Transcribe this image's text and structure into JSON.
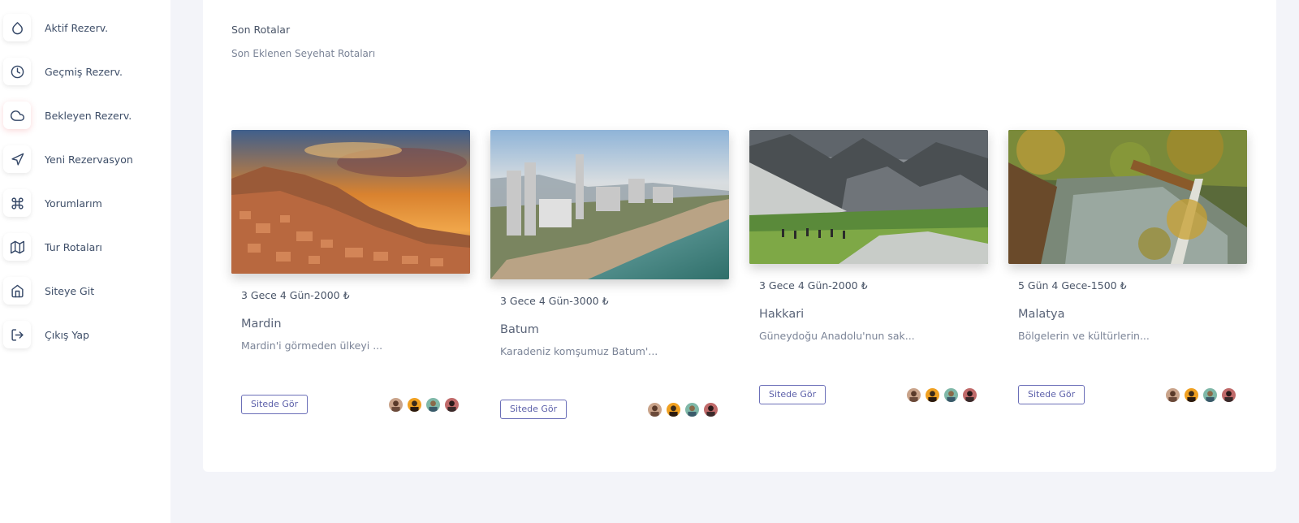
{
  "sidebar": {
    "items": [
      {
        "label": "Aktif Rezerv.",
        "icon": "droplet-icon"
      },
      {
        "label": "Geçmiş Rezerv.",
        "icon": "clock-icon"
      },
      {
        "label": "Bekleyen Rezerv.",
        "icon": "cloud-icon"
      },
      {
        "label": "Yeni Rezervasyon",
        "icon": "navigation-icon"
      },
      {
        "label": "Yorumlarım",
        "icon": "command-icon"
      },
      {
        "label": "Tur Rotaları",
        "icon": "map-icon"
      },
      {
        "label": "Siteye Git",
        "icon": "home-icon"
      },
      {
        "label": "Çıkış Yap",
        "icon": "log-out-icon"
      }
    ]
  },
  "section": {
    "title": "Son Rotalar",
    "subtitle": "Son Eklenen Seyehat Rotaları"
  },
  "cards": [
    {
      "meta": "3 Gece 4 Gün-2000 ₺",
      "title": "Mardin",
      "desc": "Mardin'i görmeden ülkeyi ...",
      "button": "Sitede Gör"
    },
    {
      "meta": "3 Gece 4 Gün-3000 ₺",
      "title": "Batum",
      "desc": "Karadeniz komşumuz Batum'...",
      "button": "Sitede Gör"
    },
    {
      "meta": "3 Gece 4 Gün-2000 ₺",
      "title": "Hakkari",
      "desc": "Güneydoğu Anadolu'nun sak...",
      "button": "Sitede Gör"
    },
    {
      "meta": "5 Gün 4 Gece-1500 ₺",
      "title": "Malatya",
      "desc": "Bölgelerin ve kültürlerin...",
      "button": "Sitede Gör"
    }
  ],
  "colors": {
    "page_background": "#f3f4f9",
    "button_border": "#6b6fb8"
  }
}
